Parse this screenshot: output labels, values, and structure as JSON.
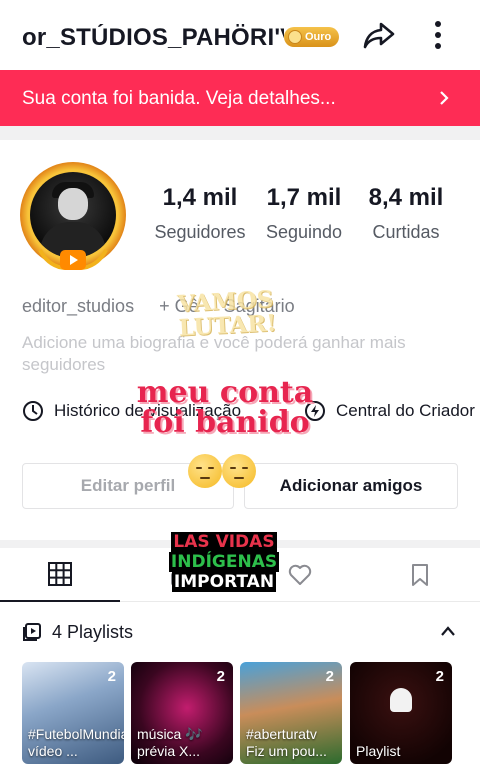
{
  "header": {
    "username": "or_STÚDIOS_PAHÖRI'V",
    "badge_label": "Ouro",
    "share_icon": "share-arrow-icon",
    "more_icon": "more-vertical-icon"
  },
  "banner": {
    "text": "Sua conta foi banida. Veja detalhes...",
    "icon": "chevron-right-icon",
    "color": "#fe2c55"
  },
  "profile": {
    "stats": [
      {
        "value": "1,4 mil",
        "label": "Seguidores"
      },
      {
        "value": "1,7 mil",
        "label": "Seguindo"
      },
      {
        "value": "8,4 mil",
        "label": "Curtidas"
      }
    ],
    "handle": "editor_studios",
    "add_tag": "+ Gê",
    "zodiac": "Sagitário",
    "bio_placeholder": "Adicione uma biografia e você poderá ganhar mais seguidores",
    "links": [
      {
        "icon": "clock-icon",
        "label": "Histórico de visualização"
      },
      {
        "icon": "lightning-icon",
        "label": "Central do Criador"
      }
    ],
    "edit_button": "Editar perfil",
    "add_friends_button": "Adicionar amigos"
  },
  "stickers": {
    "vamos": "VAMOS LUTAR!",
    "meu_conta_1": "meu conta",
    "meu_conta_2": "foi banido",
    "las_vidas_1": "LAS VIDAS",
    "las_vidas_2": "INDÍGENAS",
    "las_vidas_3": "IMPORTAN"
  },
  "tabs": [
    {
      "icon": "grid-icon",
      "active": true
    },
    {
      "icon": "lock-icon",
      "active": false
    },
    {
      "icon": "heart-icon",
      "active": false
    },
    {
      "icon": "bookmark-icon",
      "active": false
    }
  ],
  "playlists": {
    "header": "4 Playlists",
    "items": [
      {
        "count": "2",
        "caption": "#FutebolMundial vídeo ..."
      },
      {
        "count": "2",
        "caption": "música 🎶 prévia X..."
      },
      {
        "count": "2",
        "caption": "#aberturatv Fiz um pou..."
      },
      {
        "count": "2",
        "caption": "Playlist"
      }
    ]
  }
}
